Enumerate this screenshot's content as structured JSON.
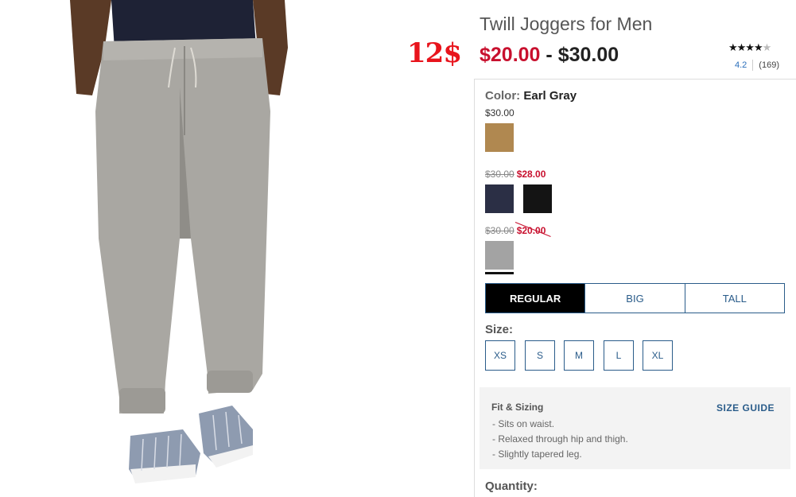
{
  "promo_sticker": "12$",
  "product": {
    "title": "Twill Joggers for Men",
    "price_low": "$20.00",
    "price_separator": "-",
    "price_high": "$30.00"
  },
  "rating": {
    "stars": "★★★★",
    "empty_star": "★",
    "score": "4.2",
    "count": "(169)"
  },
  "color": {
    "label": "Color:",
    "selected": "Earl Gray"
  },
  "price_tiers": [
    {
      "price": "$30.00"
    },
    {
      "original": "$30.00",
      "sale": "$28.00"
    },
    {
      "original": "$30.00",
      "sale": "$20.00"
    }
  ],
  "swatches": [
    {
      "name": "khaki",
      "color": "#b08850"
    },
    {
      "name": "navy",
      "color": "#2b2f45"
    },
    {
      "name": "black",
      "color": "#141414"
    },
    {
      "name": "earl-gray",
      "color": "#a3a3a3"
    }
  ],
  "fit_tabs": [
    {
      "label": "REGULAR",
      "active": true
    },
    {
      "label": "BIG",
      "active": false
    },
    {
      "label": "TALL",
      "active": false
    }
  ],
  "size": {
    "label": "Size:",
    "options": [
      "XS",
      "S",
      "M",
      "L",
      "XL"
    ]
  },
  "fit_sizing": {
    "title": "Fit & Sizing",
    "guide_link": "SIZE GUIDE",
    "bullets": [
      "Sits on waist.",
      "Relaxed through hip and thigh.",
      "Slightly tapered leg."
    ]
  },
  "quantity": {
    "label": "Quantity:"
  },
  "colors": {
    "sale_red": "#c8102e",
    "link_blue": "#2a5c8a",
    "promo_red": "#e8141c"
  }
}
